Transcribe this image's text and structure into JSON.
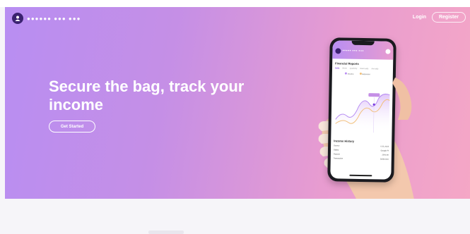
{
  "brand": {
    "name": "●●●●●● ●●● ●●●",
    "logo_icon": "avatar-logo-icon"
  },
  "nav": {
    "login": "Login",
    "register": "Register"
  },
  "hero": {
    "headline": "Secure the bag, track your income",
    "cta": "Get Started"
  },
  "phone": {
    "app_name": "●●●●● ●●● ●●●",
    "financial_reports": "Financial Reports",
    "tabs": [
      "Daily",
      "Week",
      "Quarterly",
      "Biannually",
      "Annually"
    ],
    "legend": [
      "Income",
      "Expenses"
    ],
    "income_history": "Income History",
    "history_rows": [
      [
        "Source",
        "0.01.2023"
      ],
      [
        "Salary",
        "Google Pl"
      ],
      [
        "Deposit",
        "2000.00"
      ],
      [
        "Transaction",
        "Dollar Amt"
      ]
    ]
  },
  "colors": {
    "gradient_start": "#b88ef2",
    "gradient_end": "#f5a7c6",
    "accent": "#7a3ee0",
    "logo": "#3b2270"
  }
}
